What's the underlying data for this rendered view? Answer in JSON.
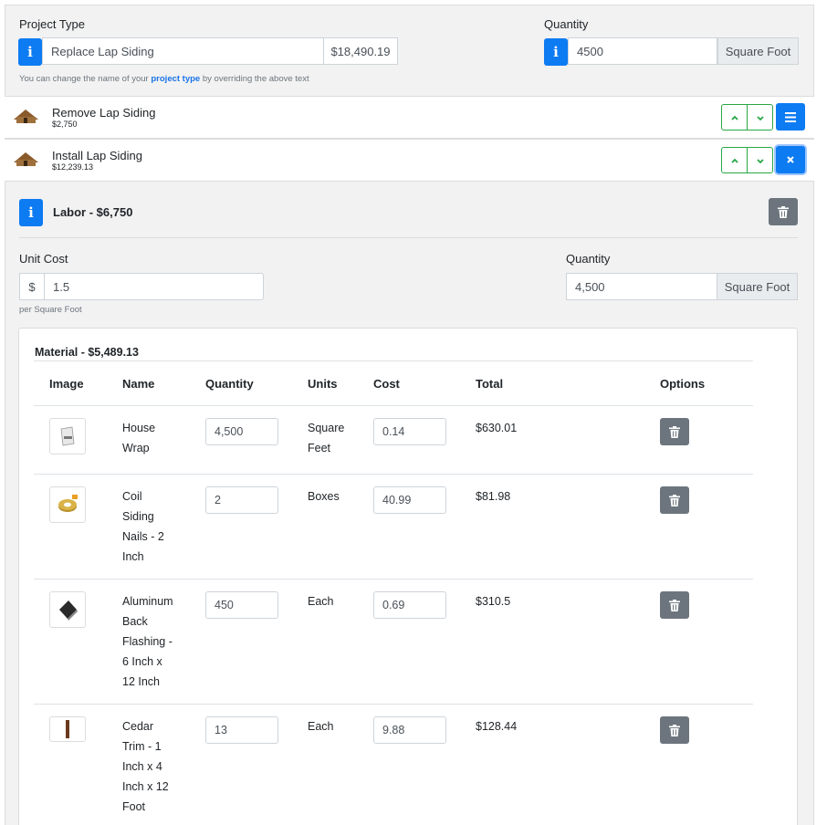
{
  "project": {
    "type_label": "Project Type",
    "type_value": "Replace Lap Siding",
    "type_price": "$18,490.19",
    "quantity_label": "Quantity",
    "quantity_value": "4500",
    "quantity_unit": "Square Foot",
    "help_prefix": "You can change the name of your ",
    "help_link": "project type",
    "help_suffix": " by overriding the above text"
  },
  "items": [
    {
      "title": "Remove Lap Siding",
      "price": "$2,750"
    },
    {
      "title": "Install Lap Siding",
      "price": "$12,239.13"
    }
  ],
  "labor": {
    "title": "Labor - $6,750",
    "unit_cost_label": "Unit Cost",
    "currency": "$",
    "unit_cost_value": "1.5",
    "unit_cost_help": "per Square Foot",
    "quantity_label": "Quantity",
    "quantity_value": "4,500",
    "quantity_unit": "Square Foot"
  },
  "material": {
    "title": "Material - $5,489.13",
    "columns": [
      "Image",
      "Name",
      "Quantity",
      "Units",
      "Cost",
      "Total",
      "Options"
    ],
    "rows": [
      {
        "name_lines": [
          "House",
          "Wrap"
        ],
        "quantity": "4,500",
        "unit_lines": [
          "Square",
          "Feet"
        ],
        "cost": "0.14",
        "total": "$630.01",
        "image": "house-wrap-icon"
      },
      {
        "name_lines": [
          "Coil",
          "Siding",
          "Nails - 2",
          "Inch"
        ],
        "quantity": "2",
        "unit_lines": [
          "Boxes"
        ],
        "cost": "40.99",
        "total": "$81.98",
        "image": "coil-nails-icon"
      },
      {
        "name_lines": [
          "Aluminum",
          "Back",
          "Flashing -",
          "6 Inch x",
          "12 Inch"
        ],
        "quantity": "450",
        "unit_lines": [
          "Each"
        ],
        "cost": "0.69",
        "total": "$310.5",
        "image": "flashing-icon"
      },
      {
        "name_lines": [
          "Cedar",
          "Trim - 1",
          "Inch x 4",
          "Inch x 12",
          "Foot"
        ],
        "quantity": "13",
        "unit_lines": [
          "Each"
        ],
        "cost": "9.88",
        "total": "$128.44",
        "image": "cedar-trim-icon"
      }
    ]
  },
  "colors": {
    "primary": "#0d7bf2",
    "success": "#28a745",
    "secondary": "#6c757d"
  }
}
